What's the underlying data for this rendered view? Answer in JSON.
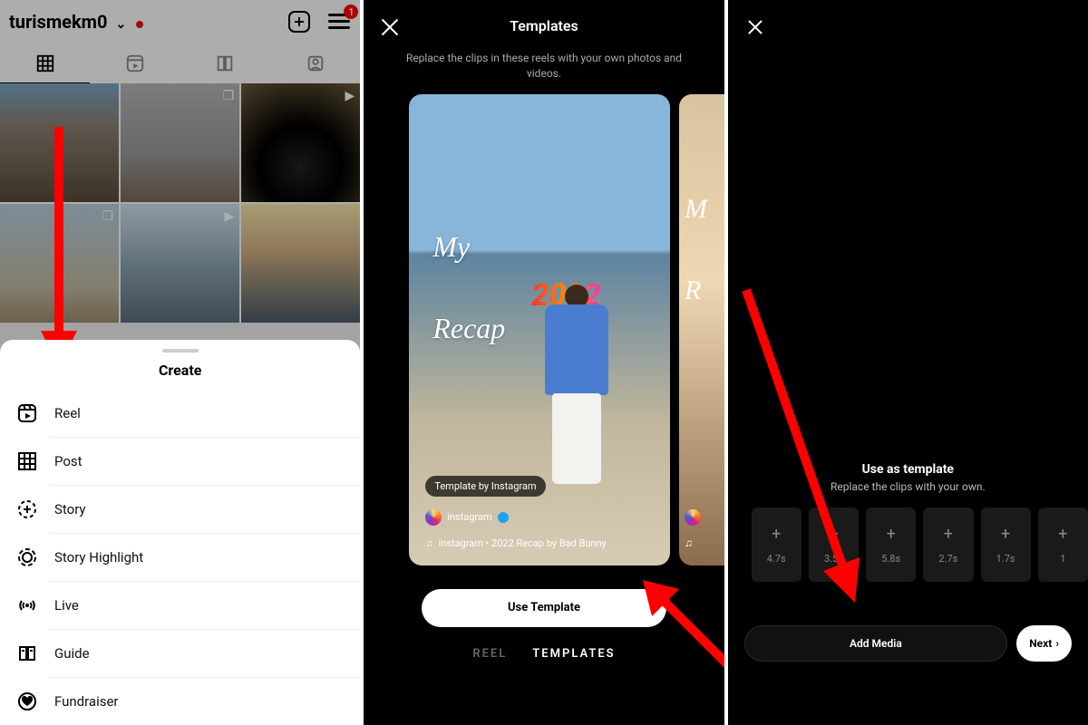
{
  "panel1": {
    "username": "turismekm0",
    "badge_count": "1",
    "sheet_title": "Create",
    "items": [
      {
        "label": "Reel"
      },
      {
        "label": "Post"
      },
      {
        "label": "Story"
      },
      {
        "label": "Story Highlight"
      },
      {
        "label": "Live"
      },
      {
        "label": "Guide"
      },
      {
        "label": "Fundraiser"
      }
    ]
  },
  "panel2": {
    "title": "Templates",
    "subtitle": "Replace the clips in these reels with your own photos and videos.",
    "template": {
      "line1": "My",
      "year": "2022",
      "line2": "Recap",
      "by_pill": "Template by Instagram",
      "author": "instagram",
      "music": "instagram • 2022 Recap by Bad Bunny"
    },
    "peek": {
      "line1": "M",
      "line2": "R"
    },
    "use_button": "Use Template",
    "tab_reel": "REEL",
    "tab_templates": "TEMPLATES"
  },
  "panel3": {
    "heading": "Use as template",
    "sub": "Replace the clips with your own.",
    "clips": [
      "4.7s",
      "3.5s",
      "5.8s",
      "2.7s",
      "1.7s",
      "1"
    ],
    "add_media": "Add Media",
    "next": "Next"
  }
}
